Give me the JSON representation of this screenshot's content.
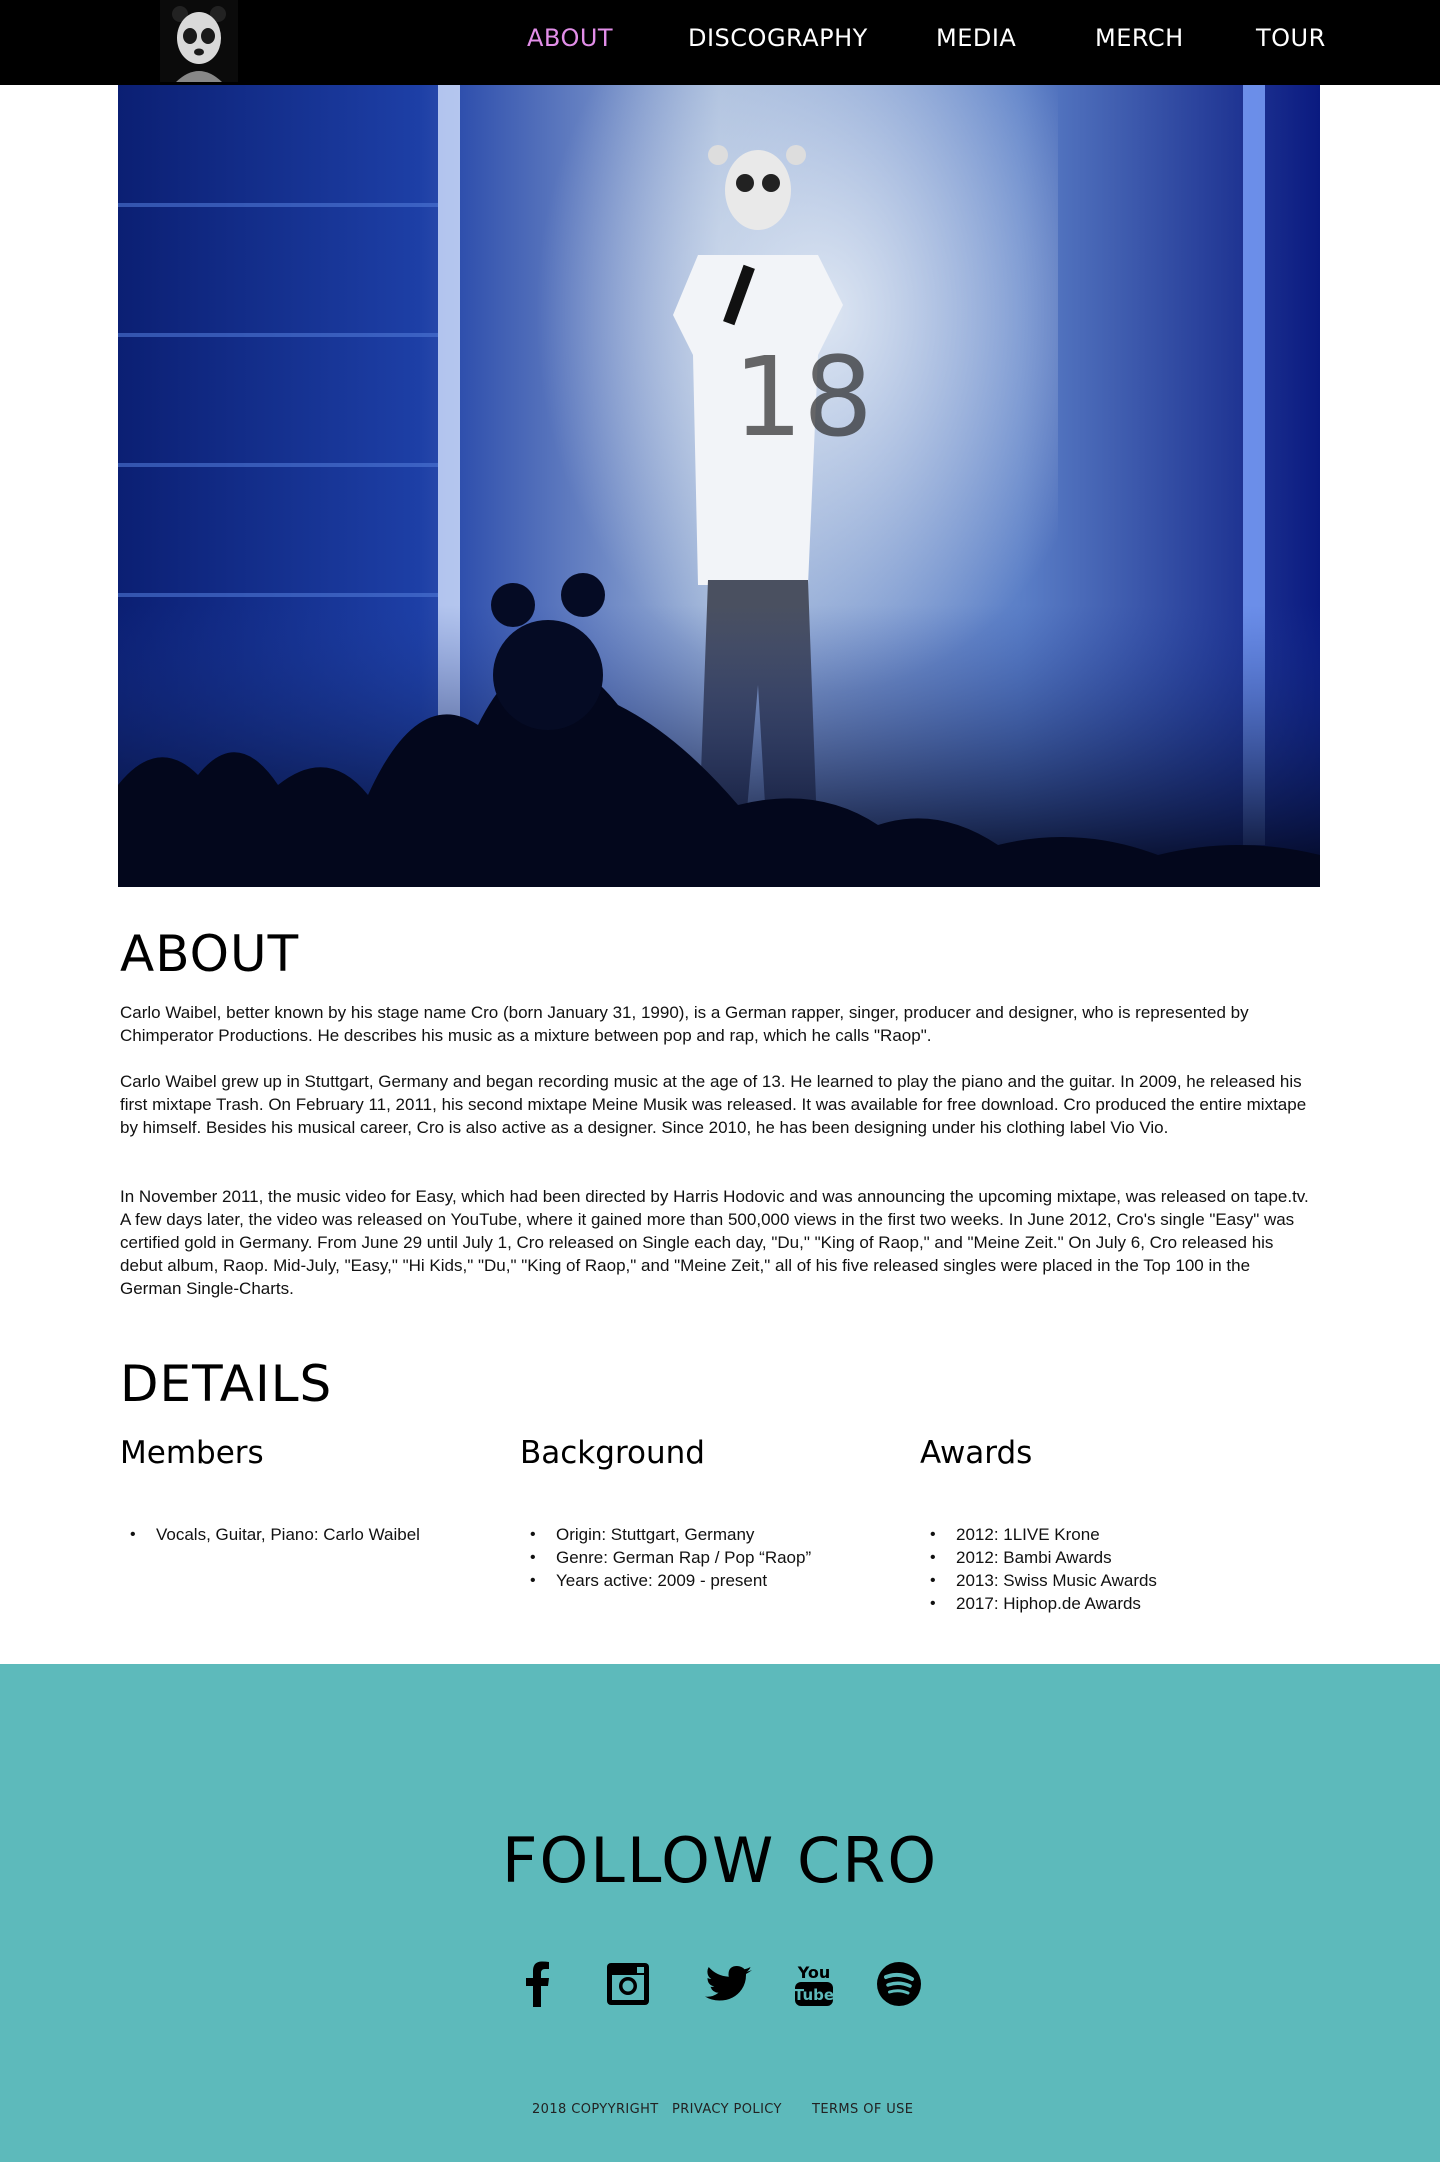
{
  "nav": {
    "logo_icon": "masked-panda-face-icon",
    "items": [
      {
        "label": "ABOUT",
        "active": true
      },
      {
        "label": "DISCOGRAPHY",
        "active": false
      },
      {
        "label": "MEDIA",
        "active": false
      },
      {
        "label": "MERCH",
        "active": false
      },
      {
        "label": "TOUR",
        "active": false
      }
    ],
    "active_color": "#e28ee8"
  },
  "hero": {
    "description_icon": "concert-photo"
  },
  "about": {
    "title": "ABOUT",
    "paragraphs": [
      "Carlo Waibel, better known by his stage name Cro (born January 31, 1990), is a German rapper, singer, producer and designer, who is represented by Chimperator Productions. He describes his music as a mixture between pop and rap, which he calls \"Raop\".",
      "Carlo Waibel grew up in Stuttgart, Germany and began recording music at the age of 13. He learned to play the piano and the guitar. In 2009, he released his first mixtape Trash. On February 11, 2011, his second mixtape Meine Musik was released. It was available for free download. Cro produced the entire mixtape by himself. Besides his musical career, Cro is also active as a designer. Since 2010, he has been designing under his clothing label Vio Vio.",
      "In November 2011, the music video for Easy, which had been directed by Harris Hodovic and was announcing the upcoming mixtape, was released on tape.tv. A few days later, the video was released on YouTube, where it gained more than 500,000 views in the first two weeks. In June 2012, Cro's single \"Easy\" was certified gold in Germany. From June 29 until July 1, Cro released on Single each day, \"Du,\" \"King of Raop,\" and \"Meine Zeit.\" On July 6, Cro released his debut album, Raop. Mid-July, \"Easy,\" \"Hi Kids,\" \"Du,\" \"King of Raop,\" and \"Meine Zeit,\" all of his five released singles were placed in the Top 100 in the German Single-Charts."
    ]
  },
  "details": {
    "title": "DETAILS",
    "columns": [
      {
        "heading": "Members",
        "items": [
          "Vocals, Guitar, Piano: Carlo Waibel"
        ]
      },
      {
        "heading": "Background",
        "items": [
          "Origin: Stuttgart, Germany",
          "Genre: German Rap / Pop “Raop”",
          "Years active: 2009 - present"
        ]
      },
      {
        "heading": "Awards",
        "items": [
          "2012: 1LIVE Krone",
          "2012: Bambi Awards",
          "2013: Swiss Music Awards",
          "2017: Hiphop.de Awards"
        ]
      }
    ]
  },
  "footer": {
    "background": "#5dbabb",
    "title": "FOLLOW CRO",
    "social": [
      "facebook-icon",
      "instagram-icon",
      "twitter-icon",
      "youtube-icon",
      "spotify-icon"
    ],
    "links": [
      "2018 COPYYRIGHT",
      "PRIVACY POLICY",
      "TERMS OF USE"
    ]
  }
}
